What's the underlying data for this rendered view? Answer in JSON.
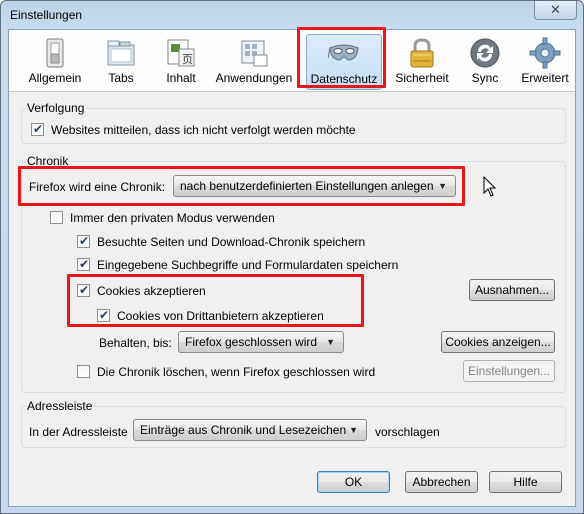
{
  "window": {
    "title": "Einstellungen",
    "close_glyph": "✕"
  },
  "toolbar": {
    "items": [
      {
        "label": "Allgemein",
        "icon": "switch-icon"
      },
      {
        "label": "Tabs",
        "icon": "tabs-icon"
      },
      {
        "label": "Inhalt",
        "icon": "content-icon"
      },
      {
        "label": "Anwendungen",
        "icon": "applications-icon"
      },
      {
        "label": "Datenschutz",
        "icon": "privacy-mask-icon",
        "selected": true
      },
      {
        "label": "Sicherheit",
        "icon": "lock-icon"
      },
      {
        "label": "Sync",
        "icon": "sync-icon"
      },
      {
        "label": "Erweitert",
        "icon": "gear-icon"
      }
    ]
  },
  "tracking": {
    "legend": "Verfolgung",
    "dnt_label": "Websites mitteilen, dass ich nicht verfolgt werden möchte",
    "dnt_checked": true
  },
  "history": {
    "legend": "Chronik",
    "mode_label": "Firefox wird eine Chronik:",
    "mode_value": "nach benutzerdefinierten Einstellungen anlegen",
    "private_label": "Immer den privaten Modus verwenden",
    "private_checked": false,
    "browsing_label": "Besuchte Seiten und Download-Chronik speichern",
    "browsing_checked": true,
    "forms_label": "Eingegebene Suchbegriffe und Formulardaten speichern",
    "forms_checked": true,
    "cookies_label": "Cookies akzeptieren",
    "cookies_checked": true,
    "exceptions_button": "Ausnahmen...",
    "third_party_label": "Cookies von Drittanbietern akzeptieren",
    "third_party_checked": true,
    "keep_label": "Behalten, bis:",
    "keep_value": "Firefox geschlossen wird",
    "show_cookies_button": "Cookies anzeigen...",
    "clear_on_close_label": "Die Chronik löschen, wenn Firefox geschlossen wird",
    "clear_on_close_checked": false,
    "settings_button": "Einstellungen..."
  },
  "locationbar": {
    "legend": "Adressleiste",
    "prefix_label": "In der Adressleiste",
    "suggest_value": "Einträge aus Chronik und Lesezeichen",
    "suffix_label": "vorschlagen"
  },
  "footer": {
    "ok": "OK",
    "cancel": "Abbrechen",
    "help": "Hilfe"
  },
  "colors": {
    "highlight_box": "#e8151b",
    "selected_tab": "#c4def6"
  }
}
